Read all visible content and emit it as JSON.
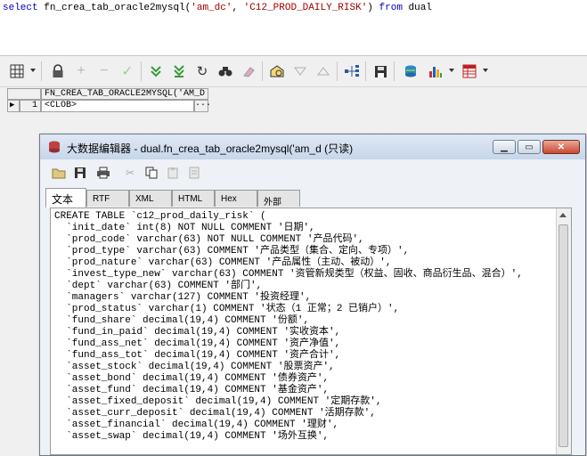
{
  "sql": {
    "kw_select": "select",
    "func": "fn_crea_tab_oracle2mysql(",
    "arg1": "'am_dc'",
    "comma": ", ",
    "arg2": "'C12_PROD_DAILY_RISK'",
    "close": ")",
    "kw_from": "from",
    "table": "dual"
  },
  "grid": {
    "column_header": "FN_CREA_TAB_ORACLE2MYSQL('AM_D",
    "row_number": "1",
    "row_indicator": "▶",
    "cell_value": "<CLOB>",
    "ellipsis": "..."
  },
  "dialog": {
    "title": "大数据编辑器 - dual.fn_crea_tab_oracle2mysql('am_d (只读)",
    "tabs": [
      "文本",
      "RTF",
      "XML",
      "HTML",
      "Hex",
      "外部"
    ],
    "lines": [
      "CREATE TABLE `c12_prod_daily_risk` (",
      "  `init_date` int(8) NOT NULL COMMENT '日期',",
      "  `prod_code` varchar(63) NOT NULL COMMENT '产品代码',",
      "  `prod_type` varchar(63) COMMENT '产品类型（集合、定向、专项）',",
      "  `prod_nature` varchar(63) COMMENT '产品属性（主动、被动）',",
      "  `invest_type_new` varchar(63) COMMENT '资管新规类型（权益、固收、商品衍生品、混合）',",
      "  `dept` varchar(63) COMMENT '部门',",
      "  `managers` varchar(127) COMMENT '投资经理',",
      "  `prod_status` varchar(1) COMMENT '状态（1 正常；2 已销户）',",
      "  `fund_share` decimal(19,4) COMMENT '份额',",
      "  `fund_in_paid` decimal(19,4) COMMENT '实收资本',",
      "  `fund_ass_net` decimal(19,4) COMMENT '资产净值',",
      "  `fund_ass_tot` decimal(19,4) COMMENT '资产合计',",
      "  `asset_stock` decimal(19,4) COMMENT '股票资产',",
      "  `asset_bond` decimal(19,4) COMMENT '债券资产',",
      "  `asset_fund` decimal(19,4) COMMENT '基金资产',",
      "  `asset_fixed_deposit` decimal(19,4) COMMENT '定期存款',",
      "  `asset_curr_deposit` decimal(19,4) COMMENT '活期存款',",
      "  `asset_financial` decimal(19,4) COMMENT '理财',",
      "  `asset_swap` decimal(19,4) COMMENT '场外互换',"
    ]
  }
}
